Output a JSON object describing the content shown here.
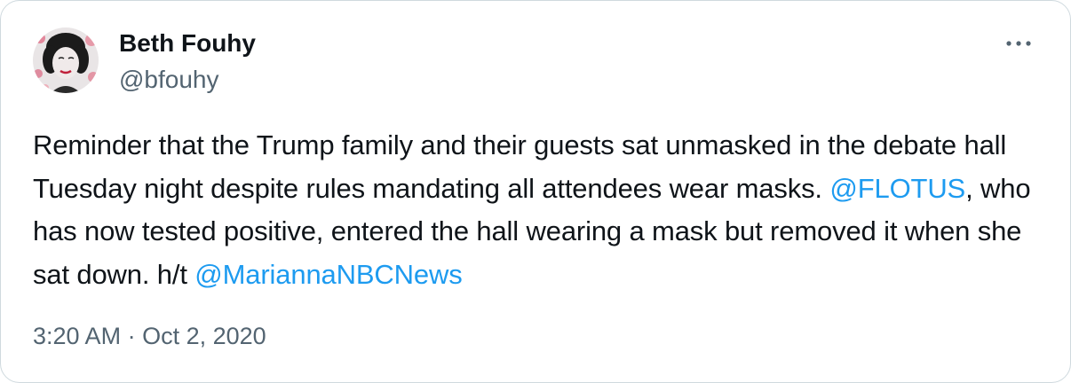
{
  "author": {
    "display_name": "Beth Fouhy",
    "handle": "@bfouhy",
    "avatar_icon": "profile-photo"
  },
  "more_icon": "more-dots-icon",
  "tweet": {
    "text_before_mention_1": "Reminder that the Trump family and their guests sat unmasked in the debate hall Tuesday night despite rules mandating all attendees wear masks. ",
    "mention_1": "@FLOTUS",
    "text_between_mentions": ", who has now tested positive, entered the hall wearing a mask but removed it when she sat down. h/t ",
    "mention_2": "@MariannaNBCNews"
  },
  "meta": {
    "time": "3:20 AM",
    "separator": " · ",
    "date": "Oct 2, 2020"
  },
  "colors": {
    "link": "#1d9bf0",
    "secondary_text": "#536471",
    "border": "#cfd9de"
  }
}
